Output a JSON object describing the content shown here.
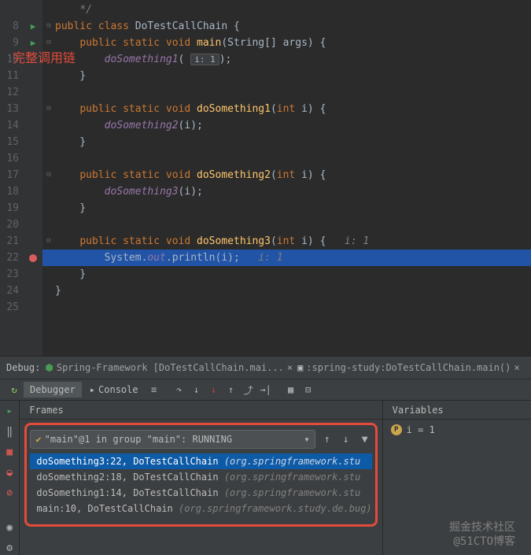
{
  "lines": [
    {
      "n": "",
      "icon": "",
      "fold": "",
      "html": "    <span class='cm'>*/</span>"
    },
    {
      "n": "8",
      "icon": "run",
      "fold": "⊟",
      "html": "<span class='kw'>public class</span> <span class='cls'>DoTestCallChain</span> {"
    },
    {
      "n": "9",
      "icon": "run",
      "fold": "⊟",
      "html": "    <span class='kw'>public static</span> <span class='typ'>void</span> <span class='mth'>main</span>(String[] args) {"
    },
    {
      "n": "10",
      "icon": "",
      "fold": "",
      "html": "        <span class='fld'>doSomething1</span>( <span class='box'>i: 1</span>);"
    },
    {
      "n": "11",
      "icon": "",
      "fold": "",
      "html": "    }"
    },
    {
      "n": "12",
      "icon": "",
      "fold": "",
      "html": ""
    },
    {
      "n": "13",
      "icon": "",
      "fold": "⊟",
      "html": "    <span class='kw'>public static</span> <span class='typ'>void</span> <span class='mth'>doSomething1</span>(<span class='typ'>int</span> i) {"
    },
    {
      "n": "14",
      "icon": "",
      "fold": "",
      "html": "        <span class='fld'>doSomething2</span>(i);"
    },
    {
      "n": "15",
      "icon": "",
      "fold": "",
      "html": "    }"
    },
    {
      "n": "16",
      "icon": "",
      "fold": "",
      "html": ""
    },
    {
      "n": "17",
      "icon": "",
      "fold": "⊟",
      "html": "    <span class='kw'>public static</span> <span class='typ'>void</span> <span class='mth'>doSomething2</span>(<span class='typ'>int</span> i) {"
    },
    {
      "n": "18",
      "icon": "",
      "fold": "",
      "html": "        <span class='fld'>doSomething3</span>(i);"
    },
    {
      "n": "19",
      "icon": "",
      "fold": "",
      "html": "    }"
    },
    {
      "n": "20",
      "icon": "",
      "fold": "",
      "html": ""
    },
    {
      "n": "21",
      "icon": "",
      "fold": "⊟",
      "html": "    <span class='kw'>public static</span> <span class='typ'>void</span> <span class='mth'>doSomething3</span>(<span class='typ'>int</span> i) {   <span class='cm'>i: 1</span>"
    },
    {
      "n": "22",
      "icon": "bp",
      "fold": "",
      "hl": true,
      "html": "        System.<span class='fld'>out</span>.println(i);   <span class='cm'>i: 1</span>"
    },
    {
      "n": "23",
      "icon": "",
      "fold": "",
      "html": "    }"
    },
    {
      "n": "24",
      "icon": "",
      "fold": "",
      "html": "}"
    },
    {
      "n": "25",
      "icon": "",
      "fold": "",
      "html": ""
    }
  ],
  "debug_label": "Debug:",
  "tab1": "Spring-Framework [DoTestCallChain.mai...",
  "tab2": ":spring-study:DoTestCallChain.main()",
  "subtab_debugger": "Debugger",
  "subtab_console": "Console",
  "frames_title": "Frames",
  "vars_title": "Variables",
  "thread_label": "\"main\"@1 in group \"main\": RUNNING",
  "stack": [
    {
      "sel": true,
      "m": "doSomething3:22, DoTestCallChain",
      "p": "(org.springframework.stu"
    },
    {
      "sel": false,
      "m": "doSomething2:18, DoTestCallChain",
      "p": "(org.springframework.stu"
    },
    {
      "sel": false,
      "m": "doSomething1:14, DoTestCallChain",
      "p": "(org.springframework.stu"
    },
    {
      "sel": false,
      "m": "main:10, DoTestCallChain",
      "p": "(org.springframework.study.de.bug)"
    }
  ],
  "var1": "i = 1",
  "annotation": "完整调用链",
  "wm1": "掘金技术社区",
  "wm2": "@51CTO博客"
}
